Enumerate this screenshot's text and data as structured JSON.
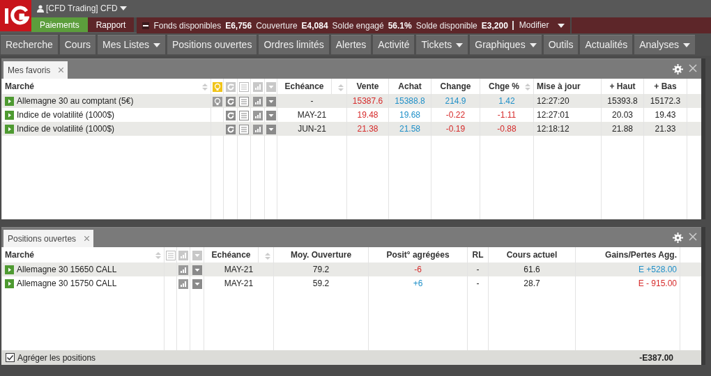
{
  "account": {
    "label": "[CFD Trading] CFD"
  },
  "header_buttons": [
    {
      "label": "Paiements",
      "kind": "payments"
    },
    {
      "label": "Rapport",
      "kind": "report"
    }
  ],
  "balances": [
    {
      "label": "Fonds disponibles",
      "value": "E6,756"
    },
    {
      "label": "Couverture",
      "value": "E4,084"
    },
    {
      "label": "Solde engagé",
      "value": "56.1%"
    },
    {
      "label": "Solde disponible",
      "value": "E3,200"
    }
  ],
  "modify": {
    "label": "Modifier"
  },
  "nav": [
    {
      "label": "Recherche",
      "dropdown": false
    },
    {
      "label": "Cours",
      "dropdown": false
    },
    {
      "label": "Mes Listes",
      "dropdown": true
    },
    {
      "label": "Positions ouvertes",
      "dropdown": false
    },
    {
      "label": "Ordres limités",
      "dropdown": false
    },
    {
      "label": "Alertes",
      "dropdown": false
    },
    {
      "label": "Activité",
      "dropdown": false
    },
    {
      "label": "Tickets",
      "dropdown": true
    },
    {
      "label": "Graphiques",
      "dropdown": true
    },
    {
      "label": "Outils",
      "dropdown": false
    },
    {
      "label": "Actualités",
      "dropdown": false
    },
    {
      "label": "Analyses",
      "dropdown": true
    }
  ],
  "favorites": {
    "tabs": [
      {
        "label": "Mes favoris",
        "selected": true
      }
    ],
    "columns": [
      "Marché",
      "Echéance",
      "Vente",
      "Achat",
      "Change",
      "Chge %",
      "Mise à jour",
      "+ Haut",
      "+ Bas"
    ],
    "rows": [
      {
        "market": "Allemagne 30 au comptant (5€)",
        "alert": true,
        "expiry": "-",
        "sell": "15387.6",
        "buy": "15388.8",
        "change": {
          "text": "214.9",
          "color": "#1e8fc8"
        },
        "change_pct": {
          "text": "1.42",
          "color": "#1e8fc8"
        },
        "updated": "12:27:20",
        "high": "15393.8",
        "low": "15172.3"
      },
      {
        "market": "Indice de volatilité (1000$)",
        "alert": false,
        "expiry": "MAY-21",
        "sell": "19.48",
        "buy": "19.68",
        "change": {
          "text": "-0.22",
          "color": "#d62a2a"
        },
        "change_pct": {
          "text": "-1.11",
          "color": "#d62a2a"
        },
        "updated": "12:27:01",
        "high": "20.03",
        "low": "19.43"
      },
      {
        "market": "Indice de volatilité (1000$)",
        "alert": false,
        "expiry": "JUN-21",
        "sell": "21.38",
        "buy": "21.58",
        "change": {
          "text": "-0.19",
          "color": "#d62a2a"
        },
        "change_pct": {
          "text": "-0.88",
          "color": "#d62a2a"
        },
        "updated": "12:18:12",
        "high": "21.88",
        "low": "21.33"
      }
    ]
  },
  "positions": {
    "tabs": [
      {
        "label": "Positions ouvertes",
        "selected": true
      }
    ],
    "columns": [
      "Marché",
      "Echéance",
      "Moy. Ouverture",
      "Posit° agrégées",
      "RL",
      "Cours actuel",
      "Gains/Pertes Agg."
    ],
    "rows": [
      {
        "market": "Allemagne 30 15650 CALL",
        "expiry": "MAY-21",
        "open": "79.2",
        "position": {
          "text": "-6",
          "color": "#d62a2a"
        },
        "rl": "-",
        "current": "61.6",
        "pnl": {
          "text": "E +528.00",
          "color": "#1e8fc8"
        }
      },
      {
        "market": "Allemagne 30 15750 CALL",
        "expiry": "MAY-21",
        "open": "59.2",
        "position": {
          "text": "+6",
          "color": "#1e8fc8"
        },
        "rl": "-",
        "current": "28.7",
        "pnl": {
          "text": "E - 915.00",
          "color": "#d62a2a"
        }
      }
    ],
    "aggregate": {
      "label": "Agréger les positions",
      "checked": true
    },
    "total": "-E387.00"
  }
}
